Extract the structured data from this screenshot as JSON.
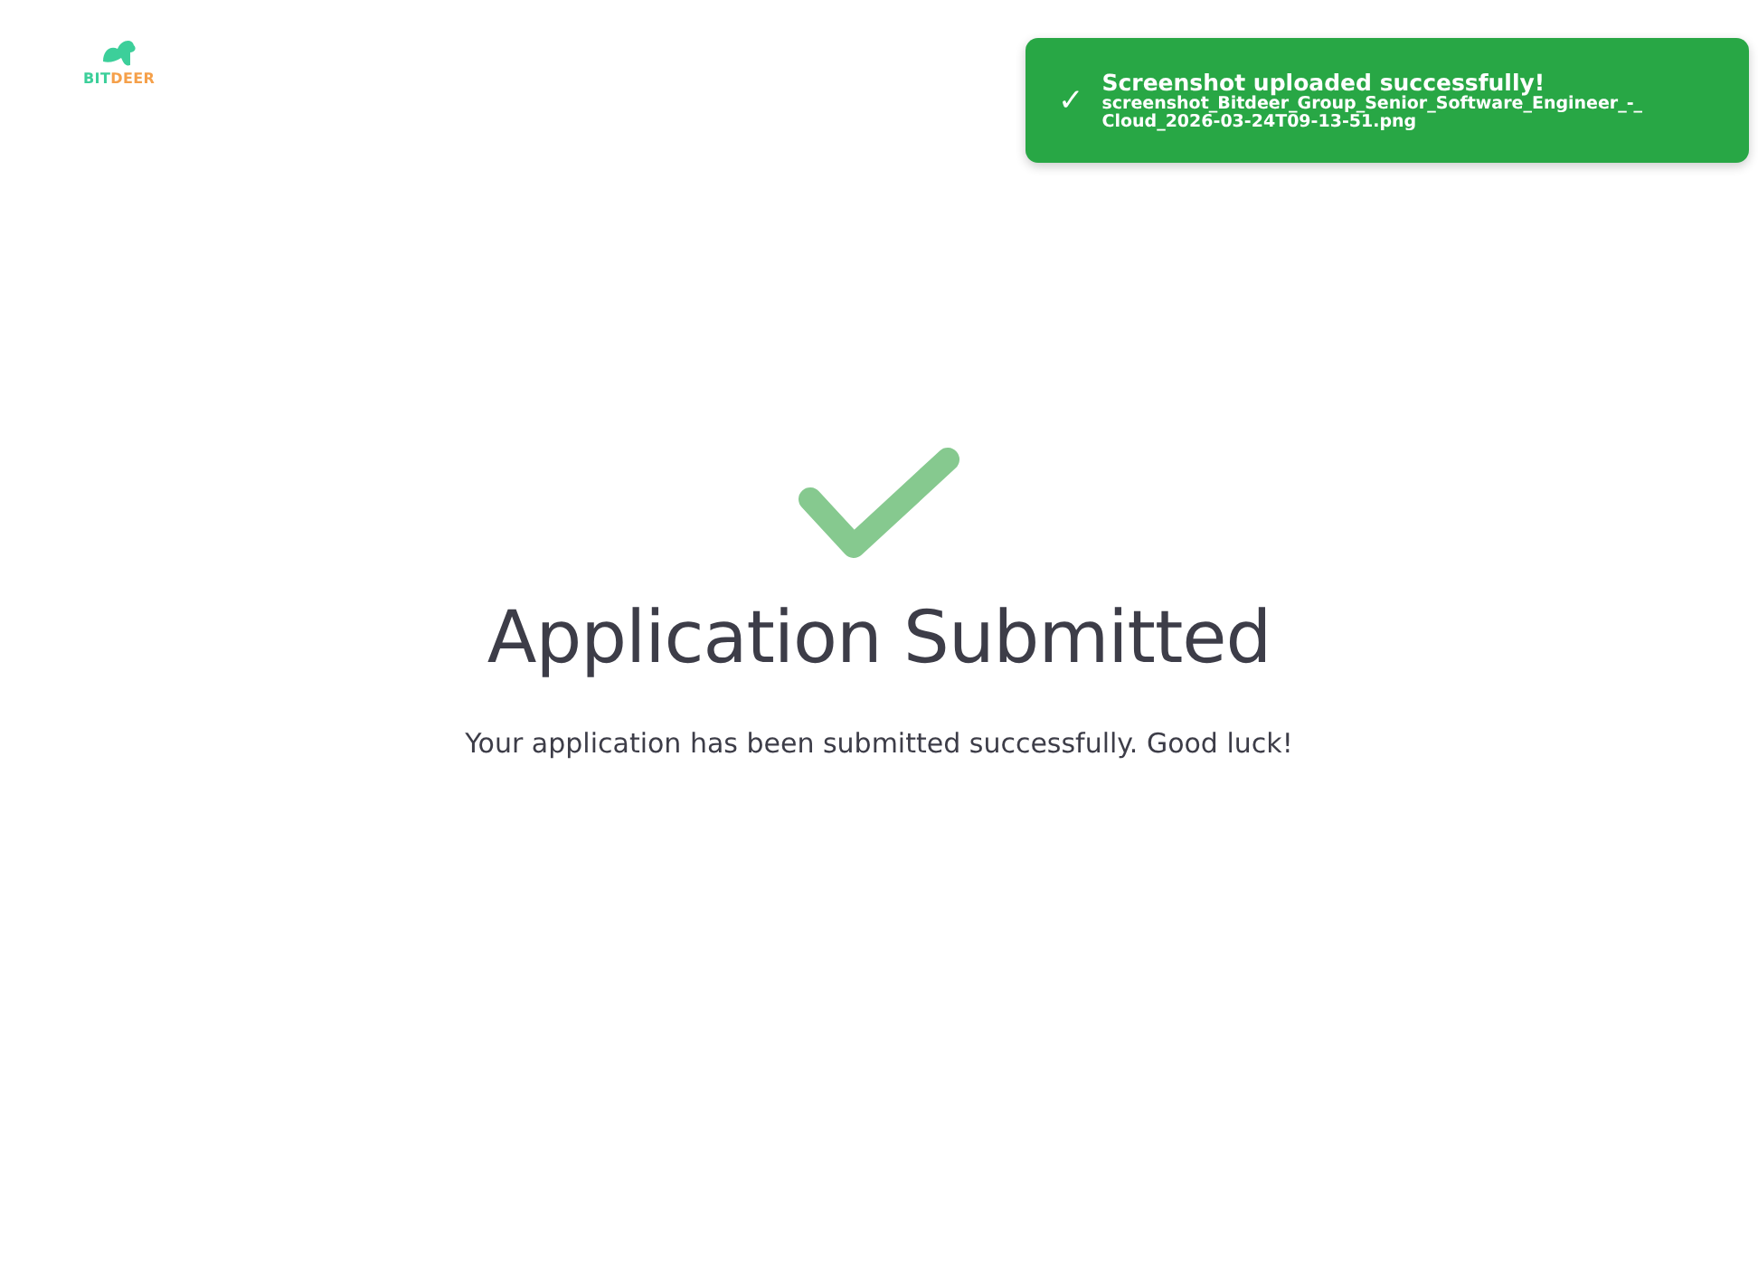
{
  "logo": {
    "parts": [
      {
        "text": "BIT",
        "color": "#3ccf9a"
      },
      {
        "text": "DEER",
        "color": "#f5a04a"
      }
    ]
  },
  "toast": {
    "icon": "✓",
    "title": "Screenshot uploaded successfully!",
    "message": "screenshot_Bitdeer_Group_Senior_Software_Engineer_-_Cloud_2026-03-24T09-13-51.png"
  },
  "heading": "Application Submitted",
  "message": "Your application has been submitted successfully. Good luck!"
}
